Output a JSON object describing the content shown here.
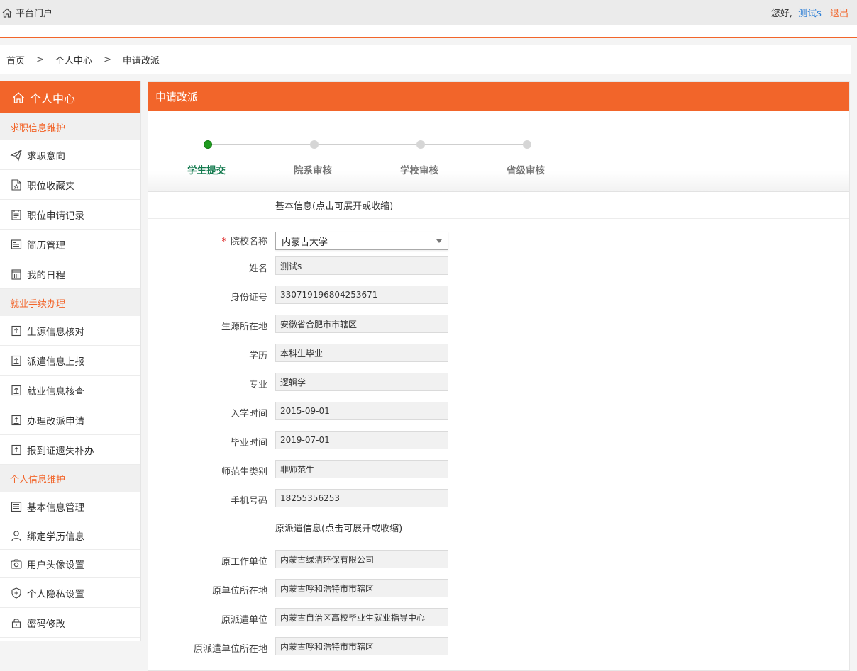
{
  "topbar": {
    "portal_label": "平台门户",
    "greeting": "您好,",
    "user_name": "测试s",
    "logout_label": "退出"
  },
  "breadcrumb": {
    "home": "首页",
    "sep1": ">",
    "center": "个人中心",
    "sep2": ">",
    "current": "申请改派"
  },
  "sidebar": {
    "title": "个人中心",
    "group1": "求职信息维护",
    "items1": [
      "求职意向",
      "职位收藏夹",
      "职位申请记录",
      "简历管理",
      "我的日程"
    ],
    "group2": "就业手续办理",
    "items2": [
      "生源信息核对",
      "派遣信息上报",
      "就业信息核查",
      "办理改派申请",
      "报到证遗失补办"
    ],
    "group3": "个人信息维护",
    "items3": [
      "基本信息管理",
      "绑定学历信息",
      "用户头像设置",
      "个人隐私设置",
      "密码修改"
    ]
  },
  "main": {
    "title": "申请改派",
    "steps": [
      "学生提交",
      "院系审核",
      "学校审核",
      "省级审核"
    ],
    "section1": "基本信息(点击可展开或收缩)",
    "school": {
      "required_mark": "*",
      "label": "院校名称",
      "value": "内蒙古大学"
    },
    "fields1": [
      {
        "label": "姓名",
        "value": "测试s"
      },
      {
        "label": "身份证号",
        "value": "330719196804253671"
      },
      {
        "label": "生源所在地",
        "value": "安徽省合肥市市辖区"
      },
      {
        "label": "学历",
        "value": "本科生毕业"
      },
      {
        "label": "专业",
        "value": "逻辑学"
      },
      {
        "label": "入学时间",
        "value": "2015-09-01"
      },
      {
        "label": "毕业时间",
        "value": "2019-07-01"
      },
      {
        "label": "师范生类别",
        "value": "非师范生"
      },
      {
        "label": "手机号码",
        "value": "18255356253"
      }
    ],
    "section2": "原派遣信息(点击可展开或收缩)",
    "fields2": [
      {
        "label": "原工作单位",
        "value": "内蒙古绿洁环保有限公司"
      },
      {
        "label": "原单位所在地",
        "value": "内蒙古呼和浩特市市辖区"
      },
      {
        "label": "原派遣单位",
        "value": "内蒙古自治区高校毕业生就业指导中心"
      },
      {
        "label": "原派遣单位所在地",
        "value": "内蒙古呼和浩特市市辖区"
      }
    ]
  },
  "colors": {
    "accent": "#f2652a",
    "link": "#2e7fd6",
    "step_active": "#137a4e"
  }
}
